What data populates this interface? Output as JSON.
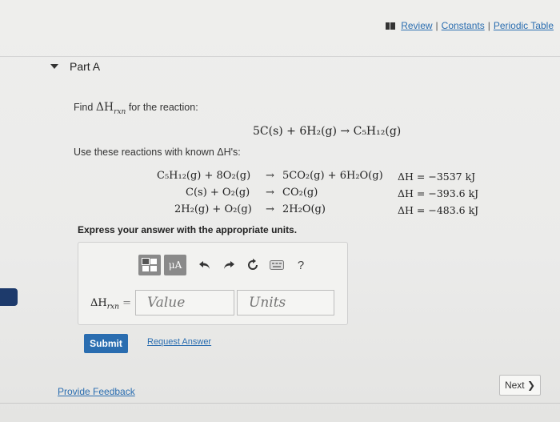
{
  "header": {
    "links": [
      "Review",
      "Constants",
      "Periodic Table"
    ],
    "separator": "|"
  },
  "part": {
    "title": "Part A"
  },
  "question": {
    "prompt": "Find ΔHₒₓₙ for the reaction:",
    "prompt_text": "Find",
    "prompt_symbol": "ΔH",
    "prompt_sub": "rxn",
    "prompt_tail": "for the reaction:",
    "main_reaction": "5C(s) + 6H₂(g) → C₅H₁₂(g)",
    "use_text": "Use these reactions with known ΔH's:",
    "reactions": [
      {
        "lhs": "C₅H₁₂(g) + 8O₂(g)",
        "arrow": "→",
        "rhs": "5CO₂(g) + 6H₂O(g)",
        "dh": "ΔH = −3537 kJ"
      },
      {
        "lhs": "C(s) + O₂(g)",
        "arrow": "→",
        "rhs": "CO₂(g)",
        "dh": "ΔH = −393.6 kJ"
      },
      {
        "lhs": "2H₂(g) + O₂(g)",
        "arrow": "→",
        "rhs": "2H₂O(g)",
        "dh": "ΔH = −483.6 kJ"
      }
    ],
    "instructions": "Express your answer with the appropriate units."
  },
  "answer": {
    "label_symbol": "ΔH",
    "label_sub": "rxn",
    "label_eq": "=",
    "value_placeholder": "Value",
    "units_placeholder": "Units",
    "toolbar": {
      "units_button": "μA",
      "help": "?"
    }
  },
  "buttons": {
    "submit": "Submit",
    "request_answer": "Request Answer",
    "provide_feedback": "Provide Feedback",
    "next": "Next",
    "next_arrow": "❯"
  },
  "colors": {
    "link": "#2a6db0",
    "submit_bg": "#2a6db0",
    "toolbar_button": "#8a8a8a"
  }
}
